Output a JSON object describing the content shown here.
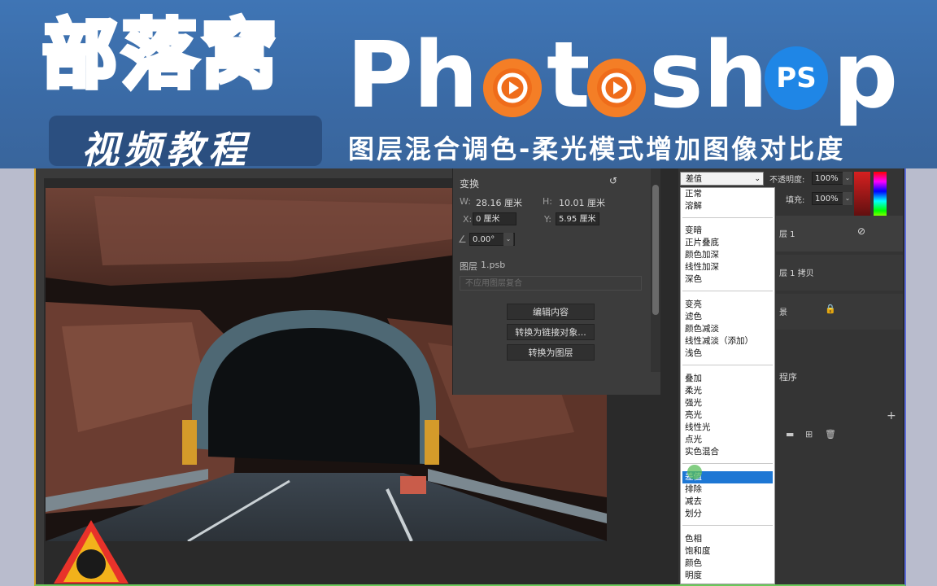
{
  "banner": {
    "brand_cn": "部落窝",
    "brand_sub": "视频教程",
    "product_letters": [
      "Ph",
      "t",
      "sh",
      "p"
    ],
    "ps_badge": "PS",
    "subtitle": "图层混合调色-柔光模式增加图像对比度"
  },
  "properties": {
    "title": "变换",
    "w_label": "W:",
    "w_value": "28.16 厘米",
    "h_label": "H:",
    "h_value": "10.01 厘米",
    "x_label": "X:",
    "x_value": "0 厘米",
    "y_label": "Y:",
    "y_value": "5.95 厘米",
    "angle_value": "0.00°",
    "layer_label": "图层",
    "layer_file": "1.psb",
    "comp_placeholder": "不应用图层复合",
    "buttons": [
      "编辑内容",
      "转换为链接对象...",
      "转换为图层"
    ]
  },
  "layers": {
    "blend_mode": "差值",
    "opacity_label": "不透明度:",
    "opacity_value": "100%",
    "fill_label": "填充:",
    "fill_value": "100%",
    "rows": [
      "层 1",
      "层 1 拷贝",
      "景"
    ],
    "side_text": "程序"
  },
  "blend_menu": {
    "groups": [
      [
        "正常",
        "溶解"
      ],
      [
        "变暗",
        "正片叠底",
        "颜色加深",
        "线性加深",
        "深色"
      ],
      [
        "变亮",
        "滤色",
        "颜色减淡",
        "线性减淡（添加）",
        "浅色"
      ],
      [
        "叠加",
        "柔光",
        "强光",
        "亮光",
        "线性光",
        "点光",
        "实色混合"
      ],
      [
        "差值",
        "排除",
        "减去",
        "划分"
      ],
      [
        "色相",
        "饱和度",
        "颜色",
        "明度"
      ]
    ],
    "selected": "差值"
  },
  "colors": {
    "banner_blue": "#3f75b5",
    "orange": "#f47e26",
    "ps_blue": "#1f86e6",
    "selection_blue": "#1e77d4"
  }
}
